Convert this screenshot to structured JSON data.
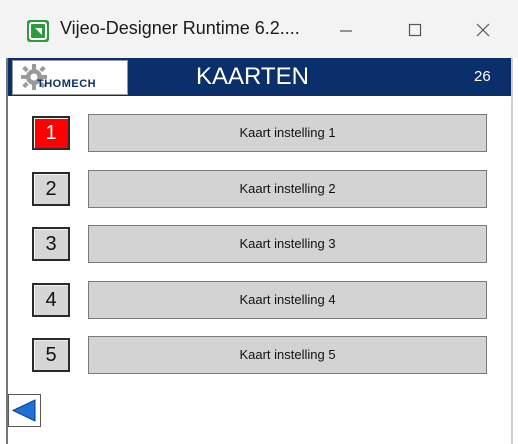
{
  "window": {
    "title": "Vijeo-Designer Runtime 6.2....",
    "icon": "vijeo-app-icon"
  },
  "header": {
    "logo_text": "THOMECH",
    "title": "KAARTEN",
    "screen_number": "26"
  },
  "rows": [
    {
      "number": "1",
      "label": "Kaart instelling 1",
      "active": true
    },
    {
      "number": "2",
      "label": "Kaart instelling 2",
      "active": false
    },
    {
      "number": "3",
      "label": "Kaart instelling 3",
      "active": false
    },
    {
      "number": "4",
      "label": "Kaart instelling 4",
      "active": false
    },
    {
      "number": "5",
      "label": "Kaart instelling 5",
      "active": false
    }
  ],
  "colors": {
    "header_bg": "#0a2f6a",
    "active_number_bg": "#ff0000",
    "button_bg": "#d3d3d3",
    "back_arrow": "#1e6fd8"
  },
  "navigation": {
    "back_icon": "left-triangle-arrow-icon"
  }
}
